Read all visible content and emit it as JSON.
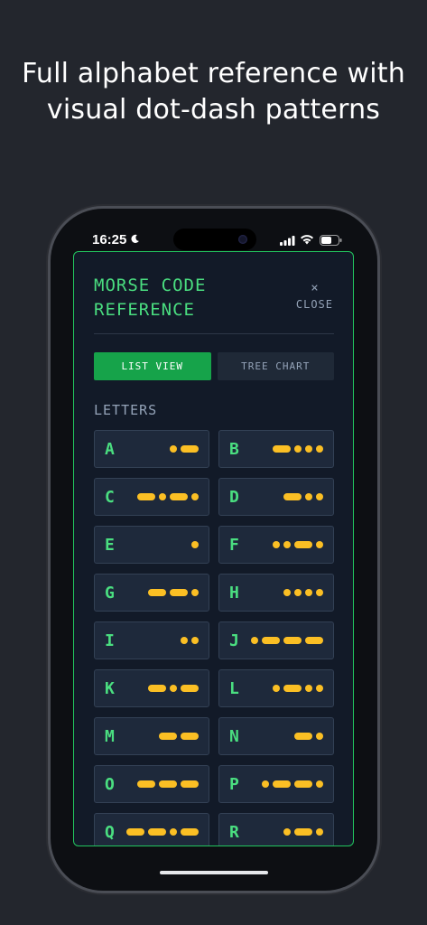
{
  "headline": "Full alphabet reference with visual dot-dash patterns",
  "status": {
    "time": "16:25"
  },
  "app": {
    "title": "MORSE CODE REFERENCE",
    "close_symbol": "×",
    "close_label": "CLOSE",
    "tabs": [
      {
        "label": "LIST VIEW",
        "active": true
      },
      {
        "label": "TREE CHART",
        "active": false
      }
    ],
    "section_title": "LETTERS",
    "letters": [
      {
        "letter": "A",
        "code": ".-"
      },
      {
        "letter": "B",
        "code": "-..."
      },
      {
        "letter": "C",
        "code": "-.-."
      },
      {
        "letter": "D",
        "code": "-.."
      },
      {
        "letter": "E",
        "code": "."
      },
      {
        "letter": "F",
        "code": "..-."
      },
      {
        "letter": "G",
        "code": "--."
      },
      {
        "letter": "H",
        "code": "...."
      },
      {
        "letter": "I",
        "code": ".."
      },
      {
        "letter": "J",
        "code": ".---"
      },
      {
        "letter": "K",
        "code": "-.-"
      },
      {
        "letter": "L",
        "code": ".-.."
      },
      {
        "letter": "M",
        "code": "--"
      },
      {
        "letter": "N",
        "code": "-."
      },
      {
        "letter": "O",
        "code": "---"
      },
      {
        "letter": "P",
        "code": ".--."
      },
      {
        "letter": "Q",
        "code": "--.-"
      },
      {
        "letter": "R",
        "code": ".-."
      }
    ]
  },
  "colors": {
    "accent": "#4ade80",
    "active_tab": "#16a34a",
    "symbol": "#fbbf24",
    "card": "#1e293b"
  }
}
